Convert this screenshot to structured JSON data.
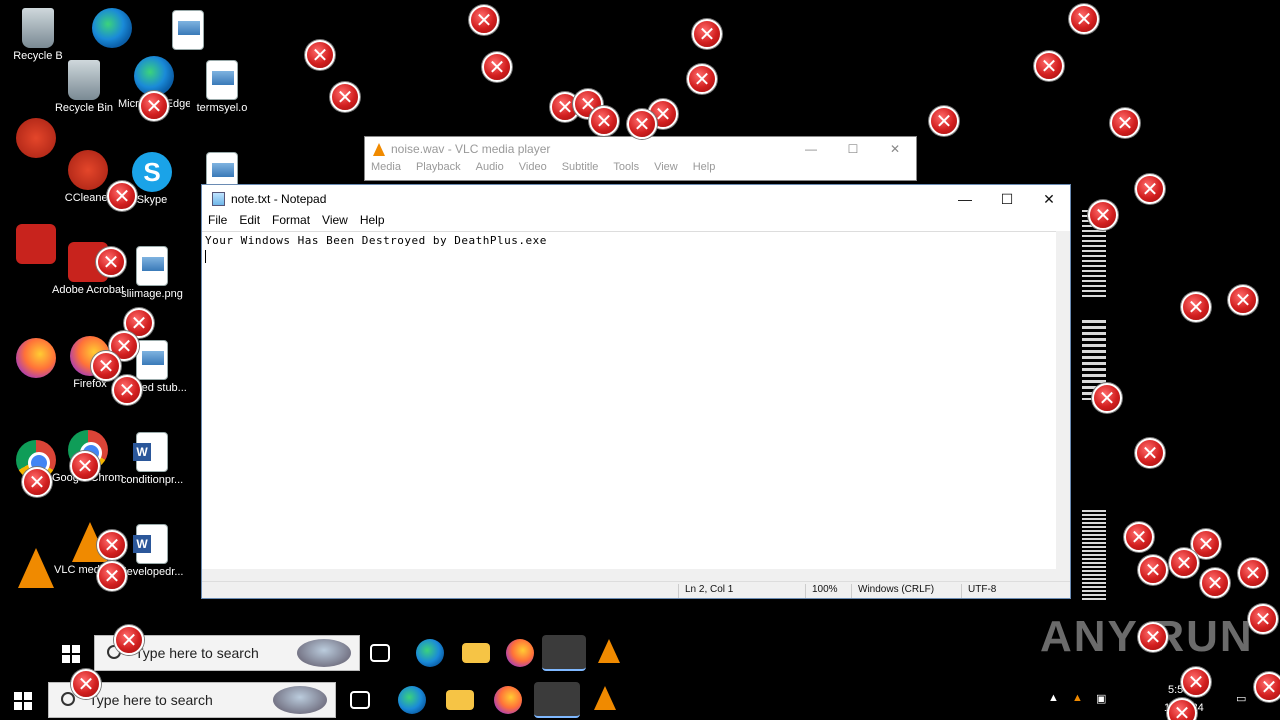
{
  "desktop": {
    "icons": [
      {
        "label": "Recycle B",
        "icon": "recycle"
      },
      {
        "label": "Recycle Bin",
        "icon": "recycle"
      },
      {
        "label": "Microsoft Edge",
        "icon": "edge"
      },
      {
        "label": "termsyel.o",
        "icon": "file"
      },
      {
        "label": "CCleaner",
        "icon": "ccleaner"
      },
      {
        "label": "Skype",
        "icon": "skype"
      },
      {
        "label": "Adobe Acrobat",
        "icon": "acrobat"
      },
      {
        "label": "sliimage.png",
        "icon": "file"
      },
      {
        "label": "Firefox",
        "icon": "firefox"
      },
      {
        "label": "opened stub...",
        "icon": "file"
      },
      {
        "label": "Google Chrome",
        "icon": "chrome"
      },
      {
        "label": "conditionpr...",
        "icon": "word"
      },
      {
        "label": "VLC media player",
        "icon": "vlc"
      },
      {
        "label": "developedr...",
        "icon": "word"
      }
    ]
  },
  "vlc_window": {
    "title": "noise.wav - VLC media player",
    "menu": [
      "Media",
      "Playback",
      "Audio",
      "Video",
      "Subtitle",
      "Tools",
      "View",
      "Help"
    ],
    "controls": {
      "minimize": "—",
      "maximize": "☐",
      "close": "✕"
    }
  },
  "notepad": {
    "title": "note.txt - Notepad",
    "menu": [
      "File",
      "Edit",
      "Format",
      "View",
      "Help"
    ],
    "content_line1": "Your Windows Has Been Destroyed by DeathPlus.exe",
    "status": {
      "position": "Ln 2, Col 1",
      "zoom": "100%",
      "line_ending": "Windows (CRLF)",
      "encoding": "UTF-8"
    },
    "controls": {
      "minimize": "—",
      "maximize": "☐",
      "close": "✕"
    }
  },
  "taskbar": {
    "search_placeholder": "Type here to search",
    "tray_time": "5:5",
    "tray_date": "10/2024"
  },
  "watermark": "ANY RUN",
  "error_glyph": "✕"
}
